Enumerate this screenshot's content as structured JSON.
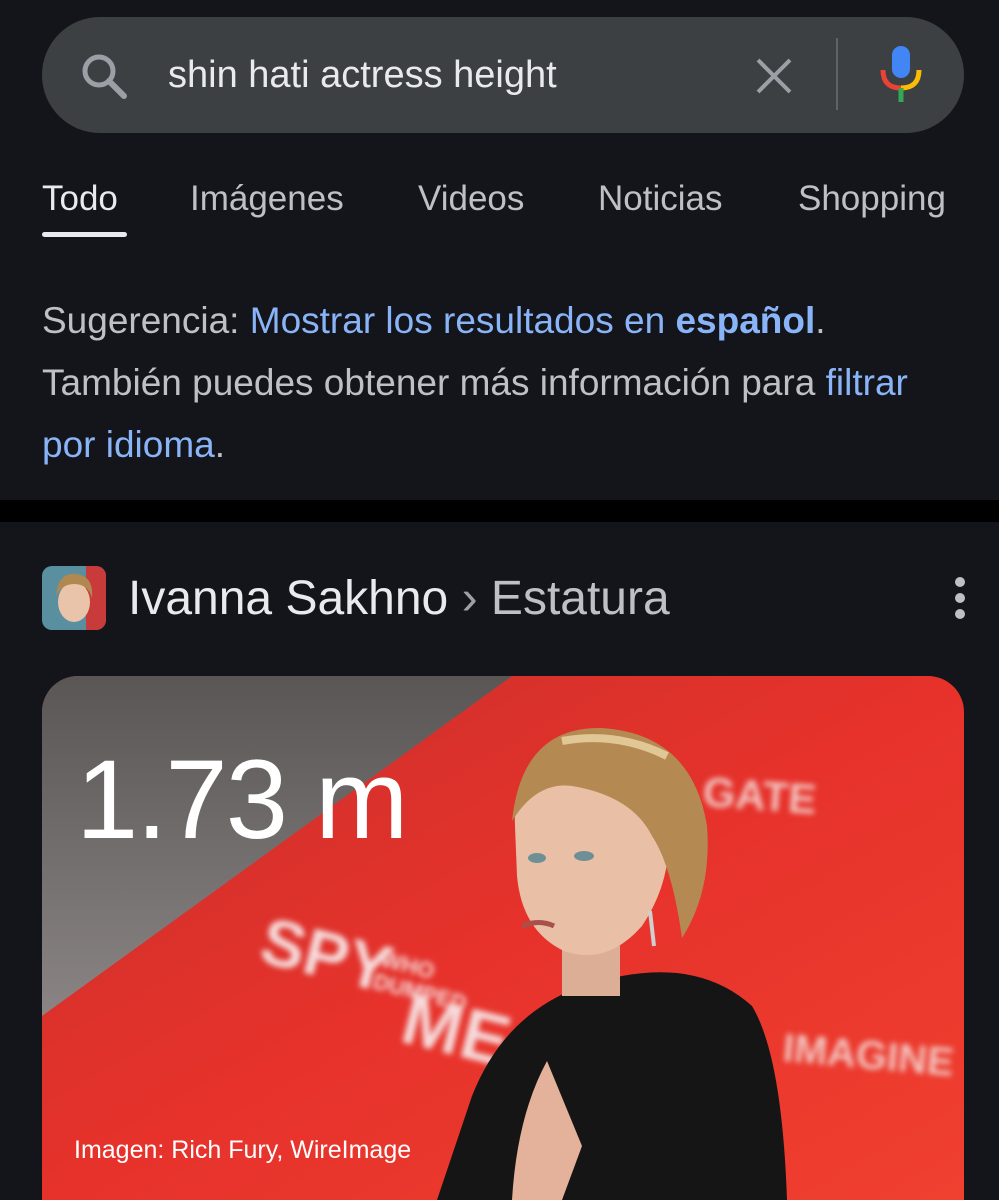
{
  "search": {
    "query": "shin hati actress height"
  },
  "tabs": [
    {
      "label": "Todo",
      "active": true
    },
    {
      "label": "Imágenes",
      "active": false
    },
    {
      "label": "Videos",
      "active": false
    },
    {
      "label": "Noticias",
      "active": false
    },
    {
      "label": "Shopping",
      "active": false
    }
  ],
  "suggestion": {
    "prefix": "Sugerencia: ",
    "link1_text": "Mostrar los resultados en ",
    "link1_bold": "español",
    "period1": ".",
    "line2": " También puedes obtener más información para ",
    "link2_text": "filtrar por idioma",
    "period2": "."
  },
  "knowledge": {
    "entity": "Ivanna Sakhno",
    "separator": "›",
    "attribute": "Estatura",
    "value": "1.73 m",
    "image_credit": "Imagen: Rich Fury, WireImage",
    "backdrop_text": [
      "SPY",
      "WHO",
      "DUMPED",
      "ME",
      "GATE",
      "IMAGINE"
    ]
  },
  "colors": {
    "background": "#14151a",
    "search_bg": "#3c4043",
    "link": "#8ab4f8",
    "card_red": "#e8322c"
  },
  "icons": [
    "search-icon",
    "clear-icon",
    "mic-icon",
    "more-vert-icon"
  ]
}
